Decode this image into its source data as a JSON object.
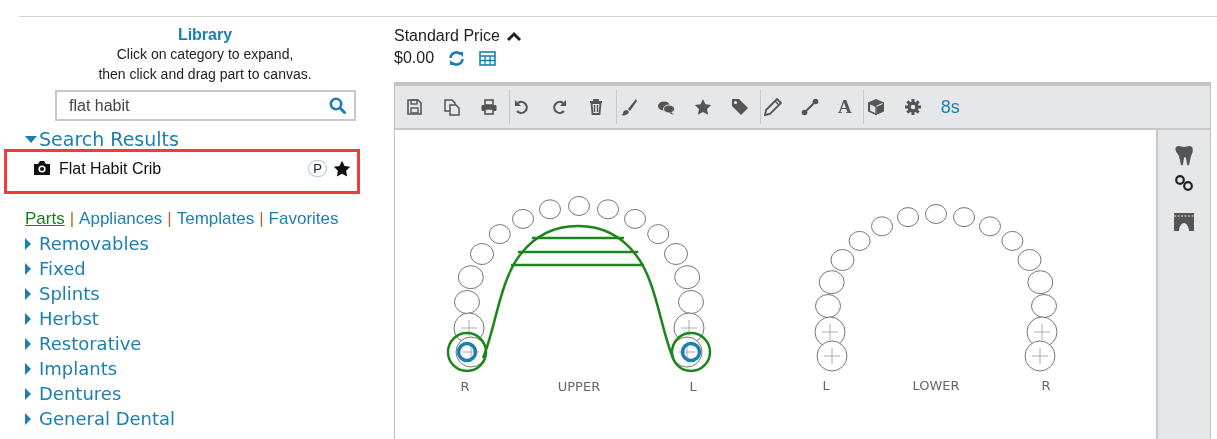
{
  "library": {
    "title": "Library",
    "instructions": "Click on category to expand,\nthen click and drag part to canvas.",
    "search": {
      "value": "flat habit"
    },
    "results": {
      "title": "Search Results",
      "expanded": true,
      "items": [
        {
          "name": "Flat Habit Crib",
          "badge": "P",
          "favorite": true,
          "selected": true
        }
      ]
    },
    "tab_separator": "|",
    "tabs": [
      {
        "label": "Parts",
        "selected": true
      },
      {
        "label": "Appliances",
        "selected": false
      },
      {
        "label": "Templates",
        "selected": false
      },
      {
        "label": "Favorites",
        "selected": false
      }
    ],
    "categories": [
      {
        "label": "Removables",
        "expanded": false
      },
      {
        "label": "Fixed",
        "expanded": false
      },
      {
        "label": "Splints",
        "expanded": false
      },
      {
        "label": "Herbst",
        "expanded": false
      },
      {
        "label": "Restorative",
        "expanded": false
      },
      {
        "label": "Implants",
        "expanded": false
      },
      {
        "label": "Dentures",
        "expanded": false
      },
      {
        "label": "General Dental",
        "expanded": false
      }
    ]
  },
  "price": {
    "title": "Standard Price",
    "expanded": true,
    "value": "$0.00"
  },
  "toolbar": {
    "text_tool": "A",
    "timer": "8s"
  },
  "canvas": {
    "arches": [
      {
        "kind": "upper",
        "left_label": "R",
        "label": "UPPER",
        "right_label": "L"
      },
      {
        "kind": "lower",
        "left_label": "L",
        "label": "LOWER",
        "right_label": "R"
      }
    ]
  }
}
